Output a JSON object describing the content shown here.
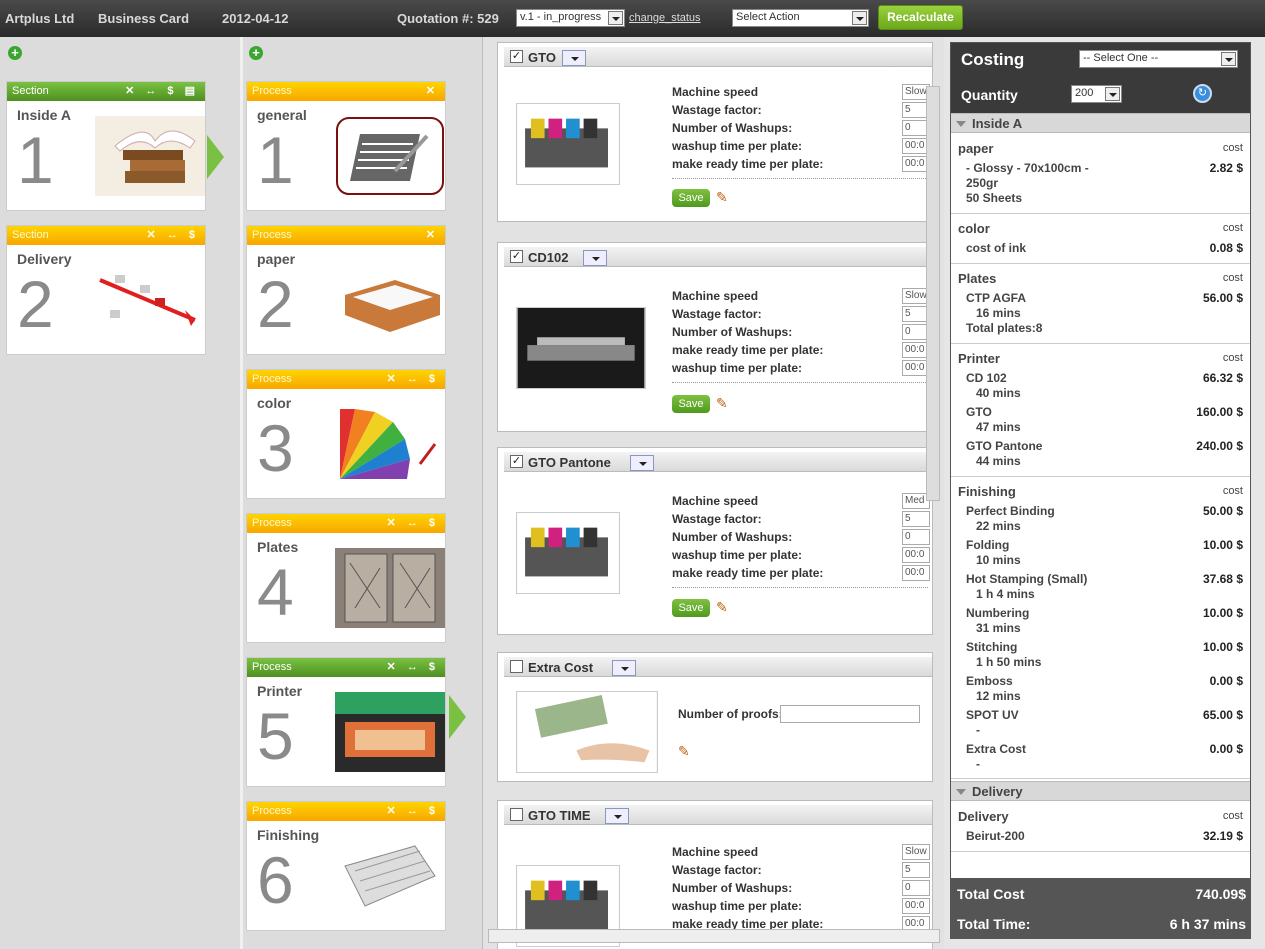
{
  "topbar": {
    "company": "Artplus Ltd",
    "product": "Business Card",
    "date": "2012-04-12",
    "quotation": "Quotation #: 529",
    "version": "v.1 - in_progress",
    "change_status": "change_status",
    "action_placeholder": "Select Action",
    "recalculate": "Recalculate"
  },
  "sections": [
    {
      "type": "Section",
      "name": "Inside A",
      "number": "1",
      "color": "green"
    },
    {
      "type": "Section",
      "name": "Delivery",
      "number": "2",
      "color": "yellow"
    }
  ],
  "processes": [
    {
      "type": "Process",
      "name": "general",
      "number": "1"
    },
    {
      "type": "Process",
      "name": "paper",
      "number": "2"
    },
    {
      "type": "Process",
      "name": "color",
      "number": "3"
    },
    {
      "type": "Process",
      "name": "Plates",
      "number": "4"
    },
    {
      "type": "Process",
      "name": "Printer",
      "number": "5"
    },
    {
      "type": "Process",
      "name": "Finishing",
      "number": "6"
    }
  ],
  "machines": [
    {
      "name": "GTO",
      "checked": "✓",
      "fields": [
        "Machine speed",
        "Wastage factor:",
        "Number of Washups:",
        "washup time per plate:",
        "make ready time per plate:"
      ],
      "values": [
        "Slow",
        "5",
        "0",
        "00:0",
        "00:0"
      ],
      "save": "Save"
    },
    {
      "name": "CD102",
      "checked": "✓",
      "fields": [
        "Machine speed",
        "Wastage factor:",
        "Number of Washups:",
        "make ready time per plate:",
        "washup time per plate:"
      ],
      "values": [
        "Slow",
        "5",
        "0",
        "00:0",
        "00:0"
      ],
      "save": "Save"
    },
    {
      "name": "GTO Pantone",
      "checked": "✓",
      "fields": [
        "Machine speed",
        "Wastage factor:",
        "Number of Washups:",
        "washup time per plate:",
        "make ready time per plate:"
      ],
      "values": [
        "Med",
        "5",
        "0",
        "00:0",
        "00:0"
      ],
      "save": "Save"
    },
    {
      "name": "Extra Cost",
      "checked": "",
      "fields": [
        "Number of proofs:"
      ],
      "values": [
        ""
      ]
    },
    {
      "name": "GTO TIME",
      "checked": "",
      "fields": [
        "Machine speed",
        "Wastage factor:",
        "Number of Washups:",
        "washup time per plate:",
        "make ready time per plate:"
      ],
      "values": [
        "Slow",
        "5",
        "0",
        "00:0",
        "00:0"
      ]
    }
  ],
  "costing": {
    "title": "Costing",
    "select_placeholder": "-- Select One --",
    "quantity_label": "Quantity",
    "quantity_value": "200",
    "cost_label": "cost",
    "section1": "Inside A",
    "section2": "Delivery",
    "paper": {
      "name": "paper",
      "item": "- Glossy - 70x100cm -\n250gr\n50 Sheets",
      "value": "2.82 $"
    },
    "color": {
      "name": "color",
      "item": "cost of ink",
      "value": "0.08 $"
    },
    "plates": {
      "name": "Plates",
      "item": "CTP AGFA",
      "sub": "16 mins",
      "extra": "Total plates:8",
      "value": "56.00 $"
    },
    "printer": {
      "name": "Printer",
      "items": [
        {
          "label": "CD 102",
          "sub": "40 mins",
          "value": "66.32 $"
        },
        {
          "label": "GTO",
          "sub": "47 mins",
          "value": "160.00 $"
        },
        {
          "label": "GTO Pantone",
          "sub": "44 mins",
          "value": "240.00 $"
        }
      ]
    },
    "finishing": {
      "name": "Finishing",
      "items": [
        {
          "label": "Perfect Binding",
          "sub": "22 mins",
          "value": "50.00 $"
        },
        {
          "label": "Folding",
          "sub": "10 mins",
          "value": "10.00 $"
        },
        {
          "label": "Hot Stamping (Small)",
          "sub": "1 h 4 mins",
          "value": "37.68 $"
        },
        {
          "label": "Numbering",
          "sub": "31 mins",
          "value": "10.00 $"
        },
        {
          "label": "Stitching",
          "sub": "1 h 50 mins",
          "value": "10.00 $"
        },
        {
          "label": "Emboss",
          "sub": "12 mins",
          "value": "0.00 $"
        },
        {
          "label": "SPOT UV",
          "sub": "-",
          "value": "65.00 $"
        },
        {
          "label": "Extra Cost",
          "sub": "-",
          "value": "0.00 $"
        }
      ]
    },
    "delivery": {
      "name": "Delivery",
      "item": "Beirut-200",
      "value": "32.19 $"
    },
    "total_cost_label": "Total Cost",
    "total_cost": "740.09$",
    "total_time_label": "Total Time:",
    "total_time": "6 h 37 mins"
  }
}
